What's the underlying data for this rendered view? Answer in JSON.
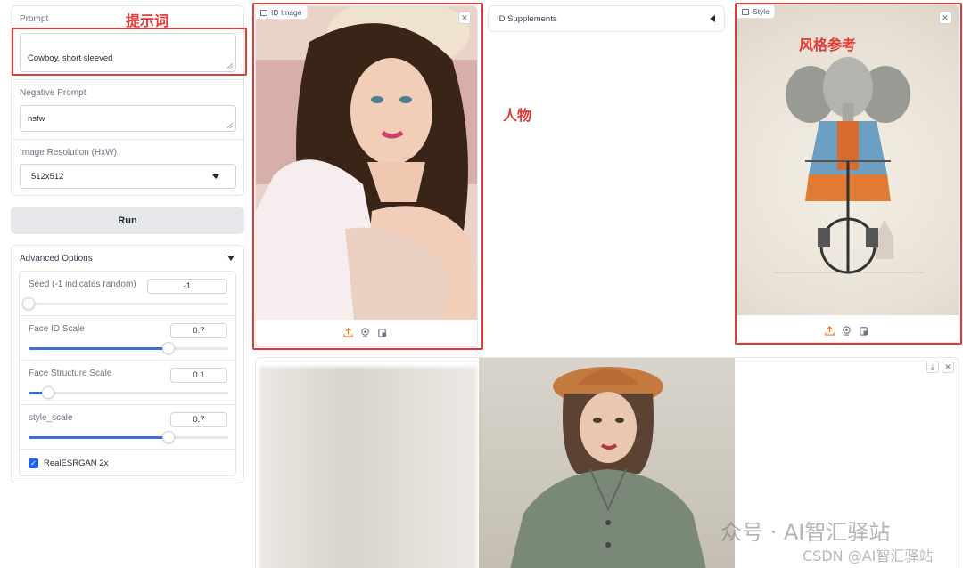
{
  "left_panel": {
    "prompt_label": "Prompt",
    "prompt_value": "Cowboy, short sleeved",
    "negative_prompt_label": "Negative Prompt",
    "negative_prompt_value": "nsfw",
    "resolution_label": "Image Resolution (HxW)",
    "resolution_value": "512x512",
    "run_label": "Run"
  },
  "advanced": {
    "title": "Advanced Options",
    "seed": {
      "label": "Seed (-1 indicates random)",
      "value": "-1",
      "fraction": 0.0
    },
    "face_id_scale": {
      "label": "Face ID Scale",
      "value": "0.7",
      "fraction": 0.7
    },
    "face_structure_scale": {
      "label": "Face Structure Scale",
      "value": "0.1",
      "fraction": 0.1
    },
    "style_scale": {
      "label": "style_scale",
      "value": "0.7",
      "fraction": 0.7
    },
    "realesrgan_label": "RealESRGAN 2x",
    "realesrgan_checked": true
  },
  "id_image": {
    "tag": "ID Image"
  },
  "id_supplements": {
    "label": "ID Supplements"
  },
  "style_image": {
    "tag": "Style"
  },
  "annotations": {
    "prompt_note": "提示词",
    "person_note": "人物",
    "style_note": "风格参考"
  },
  "watermark": {
    "line1": "众号 · AI智汇驿站",
    "line2": "CSDN @AI智汇驿站"
  },
  "colors": {
    "accent": "#3b6fd8",
    "annotation": "#e53935",
    "upload": "#f97316"
  }
}
